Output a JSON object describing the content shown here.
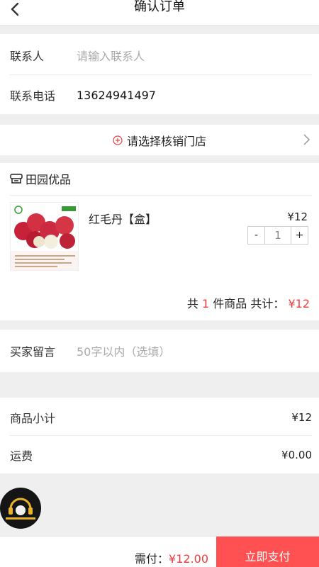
{
  "header": {
    "title": "确认订单",
    "back_icon": "chevron-left-icon"
  },
  "contact": {
    "name_label": "联系人",
    "name_placeholder": "请输入联系人",
    "phone_label": "联系电话",
    "phone_value": "13624941497"
  },
  "store_select": {
    "label": "请选择核销门店",
    "icon": "plus-circle-icon",
    "accent": "#ee3b3b"
  },
  "shop": {
    "name": "田园优品",
    "icon": "storefront-icon"
  },
  "product": {
    "name": "红毛丹【盒】",
    "price": "¥12",
    "quantity": "1",
    "minus": "-",
    "plus": "+"
  },
  "order_summary": {
    "prefix": "共",
    "count": "1",
    "middle": "件商品 共计：",
    "total": "¥12"
  },
  "message": {
    "label": "买家留言",
    "placeholder": "50字以内（选填）"
  },
  "costs": {
    "subtotal_label": "商品小计",
    "subtotal_value": "¥12",
    "shipping_label": "运费",
    "shipping_value": "¥0.00"
  },
  "footer": {
    "pay_label": "需付：",
    "pay_amount": "¥12.00",
    "pay_button": "立即支付",
    "button_color": "#ff5151"
  }
}
